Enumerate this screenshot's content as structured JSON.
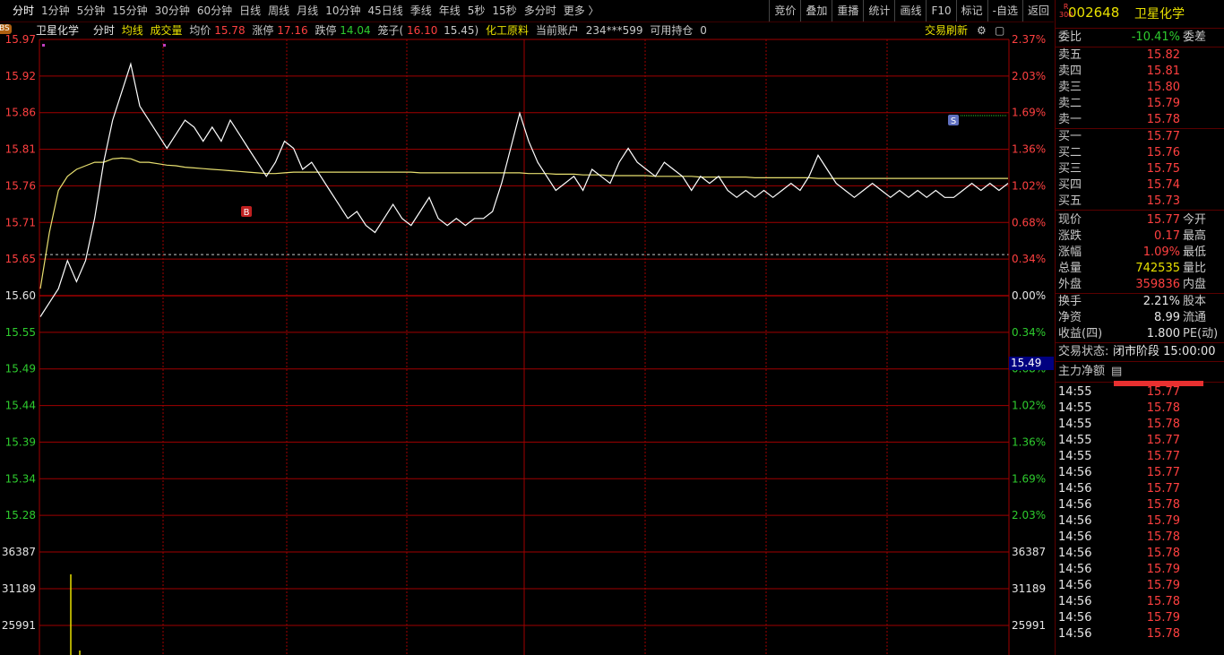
{
  "topbar": {
    "tabs": [
      "分时",
      "1分钟",
      "5分钟",
      "15分钟",
      "30分钟",
      "60分钟",
      "日线",
      "周线",
      "月线",
      "10分钟",
      "45日线",
      "季线",
      "年线",
      "5秒",
      "15秒",
      "多分时",
      "更多 〉"
    ],
    "active_tab": "分时",
    "right_buttons": [
      "竞价",
      "叠加",
      "重播",
      "统计",
      "画线",
      "F10",
      "标记",
      "-自选",
      "返回"
    ]
  },
  "infobar": {
    "bs_tag": "BS",
    "stock_name": "卫星化学",
    "mode": "分时",
    "avg_line_label": "均线",
    "volume_label": "成交量",
    "avg_price_label": "均价",
    "avg_price": "15.78",
    "limit_up_label": "涨停",
    "limit_up": "17.16",
    "limit_down_label": "跌停",
    "limit_down": "14.04",
    "tick_label": "笼子(",
    "tick_lo": "16.10",
    "tick_hi": "15.45)",
    "sector": "化工原料",
    "account_label": "当前账户",
    "account": "234***599",
    "hold_label": "可用持仓",
    "hold": "0",
    "refresh": "交易刷新"
  },
  "colors": {
    "up": "#ff4040",
    "down": "#2ecc2e",
    "price_line": "#ffffff",
    "avg_line": "#e8e070",
    "grid": "#a00000",
    "volume": "#e8e000"
  },
  "chart_data": {
    "type": "line",
    "title": "",
    "prev_close": 15.6,
    "price_ticks_left": [
      "15.97",
      "15.92",
      "15.86",
      "15.81",
      "15.76",
      "15.71",
      "15.65",
      "15.60",
      "15.55",
      "15.49",
      "15.44",
      "15.39",
      "15.34",
      "15.28"
    ],
    "pct_ticks_right": [
      "2.37%",
      "2.03%",
      "1.69%",
      "1.36%",
      "1.02%",
      "0.68%",
      "0.34%",
      "0.00%",
      "0.34%",
      "0.68%",
      "1.02%",
      "1.36%",
      "1.69%",
      "2.03%"
    ],
    "volume_ticks": [
      "36387",
      "31189",
      "25991"
    ],
    "ylim": [
      15.245,
      15.975
    ],
    "last_price_marker": "15.49",
    "series": [
      {
        "values": [
          15.58,
          15.6,
          15.62,
          15.66,
          15.63,
          15.66,
          15.72,
          15.8,
          15.86,
          15.9,
          15.94,
          15.88,
          15.86,
          15.84,
          15.82,
          15.84,
          15.86,
          15.85,
          15.83,
          15.85,
          15.83,
          15.86,
          15.84,
          15.82,
          15.8,
          15.78,
          15.8,
          15.83,
          15.82,
          15.79,
          15.8,
          15.78,
          15.76,
          15.74,
          15.72,
          15.73,
          15.71,
          15.7,
          15.72,
          15.74,
          15.72,
          15.71,
          15.73,
          15.75,
          15.72,
          15.71,
          15.72,
          15.71,
          15.72,
          15.72,
          15.73,
          15.77,
          15.82,
          15.87,
          15.83,
          15.8,
          15.78,
          15.76,
          15.77,
          15.78,
          15.76,
          15.79,
          15.78,
          15.77,
          15.8,
          15.82,
          15.8,
          15.79,
          15.78,
          15.8,
          15.79,
          15.78,
          15.76,
          15.78,
          15.77,
          15.78,
          15.76,
          15.75,
          15.76,
          15.75,
          15.76,
          15.75,
          15.76,
          15.77,
          15.76,
          15.78,
          15.81,
          15.79,
          15.77,
          15.76,
          15.75,
          15.76,
          15.77,
          15.76,
          15.75,
          15.76,
          15.75,
          15.76,
          15.75,
          15.76,
          15.75,
          15.75,
          15.76,
          15.77,
          15.76,
          15.77,
          15.76,
          15.77
        ]
      },
      {
        "values": [
          15.62,
          15.7,
          15.76,
          15.78,
          15.79,
          15.795,
          15.8,
          15.8,
          15.805,
          15.806,
          15.805,
          15.8,
          15.8,
          15.798,
          15.796,
          15.795,
          15.793,
          15.792,
          15.791,
          15.79,
          15.789,
          15.788,
          15.787,
          15.786,
          15.785,
          15.784,
          15.784,
          15.785,
          15.786,
          15.786,
          15.786,
          15.786,
          15.786,
          15.786,
          15.786,
          15.786,
          15.786,
          15.786,
          15.786,
          15.786,
          15.786,
          15.786,
          15.785,
          15.785,
          15.785,
          15.785,
          15.785,
          15.785,
          15.785,
          15.785,
          15.785,
          15.785,
          15.785,
          15.785,
          15.784,
          15.784,
          15.784,
          15.783,
          15.783,
          15.783,
          15.782,
          15.782,
          15.782,
          15.781,
          15.781,
          15.781,
          15.781,
          15.781,
          15.78,
          15.78,
          15.78,
          15.78,
          15.78,
          15.779,
          15.779,
          15.779,
          15.779,
          15.779,
          15.779,
          15.778,
          15.778,
          15.778,
          15.778,
          15.778,
          15.778,
          15.778,
          15.777,
          15.777,
          15.777,
          15.777,
          15.777,
          15.777,
          15.777,
          15.777,
          15.777,
          15.777,
          15.777,
          15.777,
          15.777,
          15.777,
          15.777,
          15.777,
          15.777,
          15.777,
          15.777,
          15.777,
          15.777,
          15.777
        ]
      }
    ]
  },
  "right": {
    "code": "002648",
    "name": "卫星化学",
    "r_label": "R\n300",
    "webi_label": "委比",
    "webi": "-10.41%",
    "wecha_label": "委差",
    "asks": [
      {
        "label": "卖五",
        "price": "15.82"
      },
      {
        "label": "卖四",
        "price": "15.81"
      },
      {
        "label": "卖三",
        "price": "15.80"
      },
      {
        "label": "卖二",
        "price": "15.79"
      },
      {
        "label": "卖一",
        "price": "15.78"
      }
    ],
    "bids": [
      {
        "label": "买一",
        "price": "15.77"
      },
      {
        "label": "买二",
        "price": "15.76"
      },
      {
        "label": "买三",
        "price": "15.75"
      },
      {
        "label": "买四",
        "price": "15.74"
      },
      {
        "label": "买五",
        "price": "15.73"
      }
    ],
    "stats": [
      {
        "l": "现价",
        "v": "15.77",
        "l2": "今开",
        "c": "red"
      },
      {
        "l": "涨跌",
        "v": "0.17",
        "l2": "最高",
        "c": "red"
      },
      {
        "l": "涨幅",
        "v": "1.09%",
        "l2": "最低",
        "c": "red"
      },
      {
        "l": "总量",
        "v": "742535",
        "l2": "量比",
        "c": "yellow"
      },
      {
        "l": "外盘",
        "v": "359836",
        "l2": "内盘",
        "c": "red"
      }
    ],
    "stats2": [
      {
        "l": "换手",
        "v": "2.21%",
        "l2": "股本",
        "c": "white"
      },
      {
        "l": "净资",
        "v": "8.99",
        "l2": "流通",
        "c": "white"
      },
      {
        "l": "收益(四)",
        "v": "1.800",
        "l2": "PE(动)",
        "c": "white"
      }
    ],
    "status_label": "交易状态:",
    "status": "闭市阶段 15:00:00",
    "main_force_label": "主力净额",
    "ticks": [
      {
        "t": "14:55",
        "p": "15.77"
      },
      {
        "t": "14:55",
        "p": "15.78"
      },
      {
        "t": "14:55",
        "p": "15.78"
      },
      {
        "t": "14:55",
        "p": "15.77"
      },
      {
        "t": "14:55",
        "p": "15.77"
      },
      {
        "t": "14:56",
        "p": "15.77"
      },
      {
        "t": "14:56",
        "p": "15.77"
      },
      {
        "t": "14:56",
        "p": "15.78"
      },
      {
        "t": "14:56",
        "p": "15.79"
      },
      {
        "t": "14:56",
        "p": "15.78"
      },
      {
        "t": "14:56",
        "p": "15.78"
      },
      {
        "t": "14:56",
        "p": "15.79"
      },
      {
        "t": "14:56",
        "p": "15.79"
      },
      {
        "t": "14:56",
        "p": "15.78"
      },
      {
        "t": "14:56",
        "p": "15.79"
      },
      {
        "t": "14:56",
        "p": "15.78"
      }
    ]
  }
}
